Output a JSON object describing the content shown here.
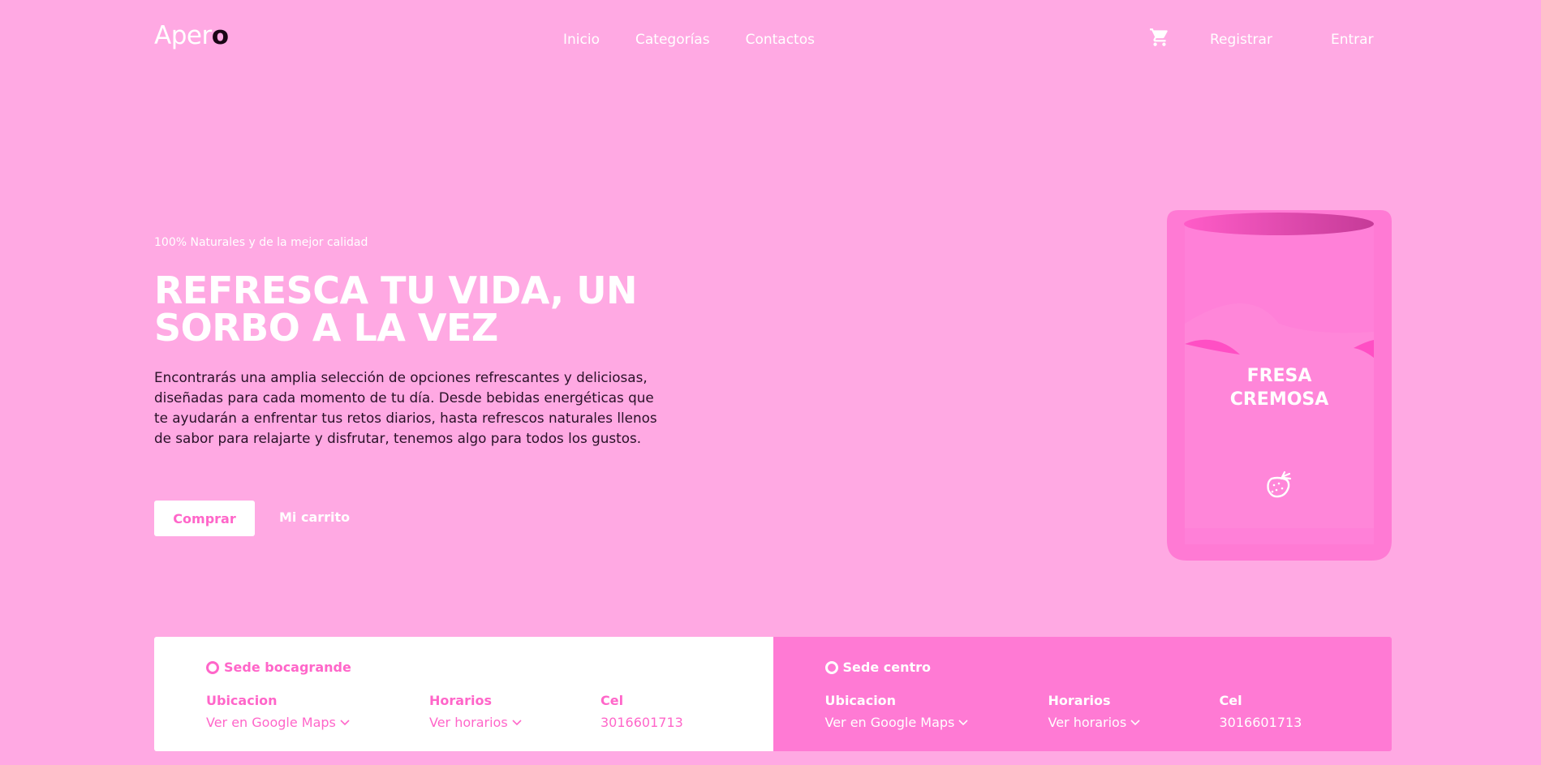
{
  "header": {
    "logo_main": "Aper",
    "logo_accent": "o",
    "nav": [
      "Inicio",
      "Categorías",
      "Contactos"
    ],
    "cart_icon": "cart-icon",
    "register": "Registrar",
    "login": "Entrar"
  },
  "hero": {
    "eyebrow": "100% Naturales y de la mejor calidad",
    "headline": "REFRESCA TU VIDA, UN SORBO A LA VEZ",
    "description": "Encontrarás una amplia selección de opciones refrescantes y deliciosas, diseñadas para cada momento de tu día. Desde bebidas energéticas que te ayudarán a enfrentar tus retos diarios, hasta refrescos naturales llenos de sabor para relajarte y disfrutar, tenemos algo para todos los gustos.",
    "buy_button": "Comprar",
    "cart_link": "Mi carrito"
  },
  "product": {
    "label_line1": "FRESA",
    "label_line2": "CREMOSA",
    "icon": "strawberry-icon"
  },
  "locations": [
    {
      "name": "Sede bocagrande",
      "location_label": "Ubicacion",
      "location_value": "Ver en Google Maps",
      "hours_label": "Horarios",
      "hours_value": "Ver horarios",
      "phone_label": "Cel",
      "phone_value": "3016601713"
    },
    {
      "name": "Sede centro",
      "location_label": "Ubicacion",
      "location_value": "Ver en Google Maps",
      "hours_label": "Horarios",
      "hours_value": "Ver horarios",
      "phone_label": "Cel",
      "phone_value": "3016601713"
    }
  ],
  "colors": {
    "background": "#ffa9e3",
    "accent": "#ff66c9",
    "panel_dark": "#ff7ad4",
    "text_dark": "#2a1128"
  }
}
